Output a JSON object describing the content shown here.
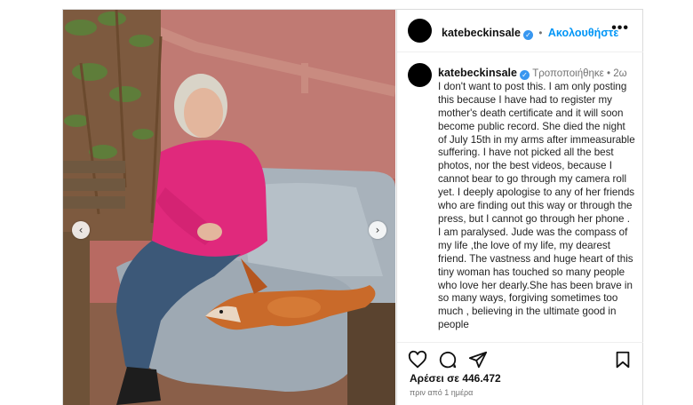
{
  "post": {
    "username": "katebeckinsale",
    "follow_label": "Ακολουθήστε",
    "more_label": "•••",
    "caption": {
      "edited_label": "Τροποποιήθηκε",
      "separator": "•",
      "age": "2ω",
      "text": "I don't want to post this. I am only posting this because I have had to register my mother's death certificate and it will soon become public record. She died the night of July 15th  in my arms after immeasurable suffering. I have not picked all the best photos, nor the best videos, because I cannot bear to go through my camera roll yet. I deeply apologise to any of her friends who are finding out this way or through the press, but I cannot go through her phone . I am paralysed. Jude was the compass of my life ,the love of my life, my dearest friend. The vastness and huge heart  of this tiny woman has touched so many people who love her dearly.She has been brave in so many ways, forgiving sometimes too much , believing in the ultimate good in people"
    },
    "likes": "Αρέσει σε 446.472",
    "timestamp": "πριν από 1 ημέρα",
    "icons": {
      "like": "heart-icon",
      "comment": "comment-icon",
      "share": "share-icon",
      "save": "bookmark-icon",
      "verified": "verified-badge-icon",
      "prev": "chevron-left-icon",
      "next": "chevron-right-icon"
    },
    "colors": {
      "link": "#0095f6",
      "verified": "#3897f0",
      "muted": "#737373"
    }
  }
}
